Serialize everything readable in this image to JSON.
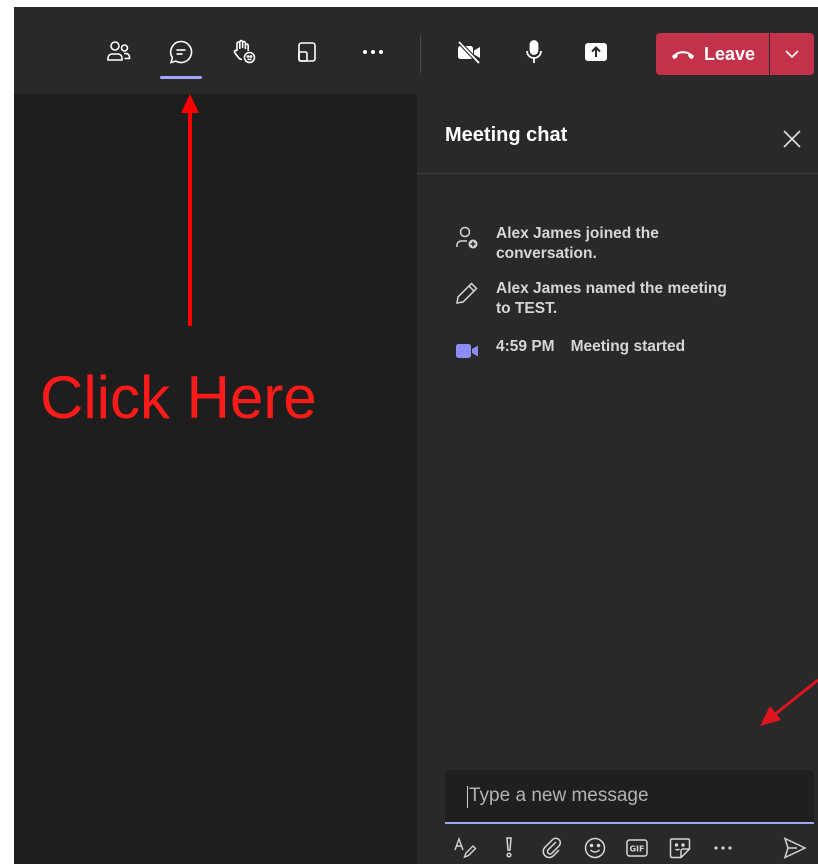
{
  "toolbar": {
    "buttons": [
      {
        "name": "people",
        "icon": "people-icon"
      },
      {
        "name": "chat",
        "icon": "chat-icon",
        "active": true
      },
      {
        "name": "raise-hand",
        "icon": "raise-hand-icon"
      },
      {
        "name": "view",
        "icon": "view-icon"
      },
      {
        "name": "more",
        "icon": "more-icon"
      },
      {
        "name": "camera",
        "icon": "camera-off-icon"
      },
      {
        "name": "mic",
        "icon": "mic-icon"
      },
      {
        "name": "share",
        "icon": "share-icon"
      }
    ],
    "leave_label": "Leave"
  },
  "chat": {
    "title": "Meeting chat",
    "events": [
      {
        "icon": "person-add-icon",
        "text": "Alex James joined the conversation."
      },
      {
        "icon": "pencil-icon",
        "text": "Alex James named the meeting to TEST."
      },
      {
        "icon": "video-icon",
        "time": "4:59 PM",
        "text": "Meeting started"
      }
    ],
    "composer": {
      "placeholder": "Type a new message",
      "value": ""
    },
    "tools": [
      "format-icon",
      "important-icon",
      "attach-icon",
      "emoji-icon",
      "gif-icon",
      "sticker-icon",
      "more-icon",
      "send-icon"
    ]
  },
  "annotation": {
    "label": "Click Here"
  },
  "colors": {
    "accent": "#9ea6ff",
    "leave": "#c4314b",
    "annotation": "#ff1a1a",
    "video_icon": "#8b8cf4"
  }
}
